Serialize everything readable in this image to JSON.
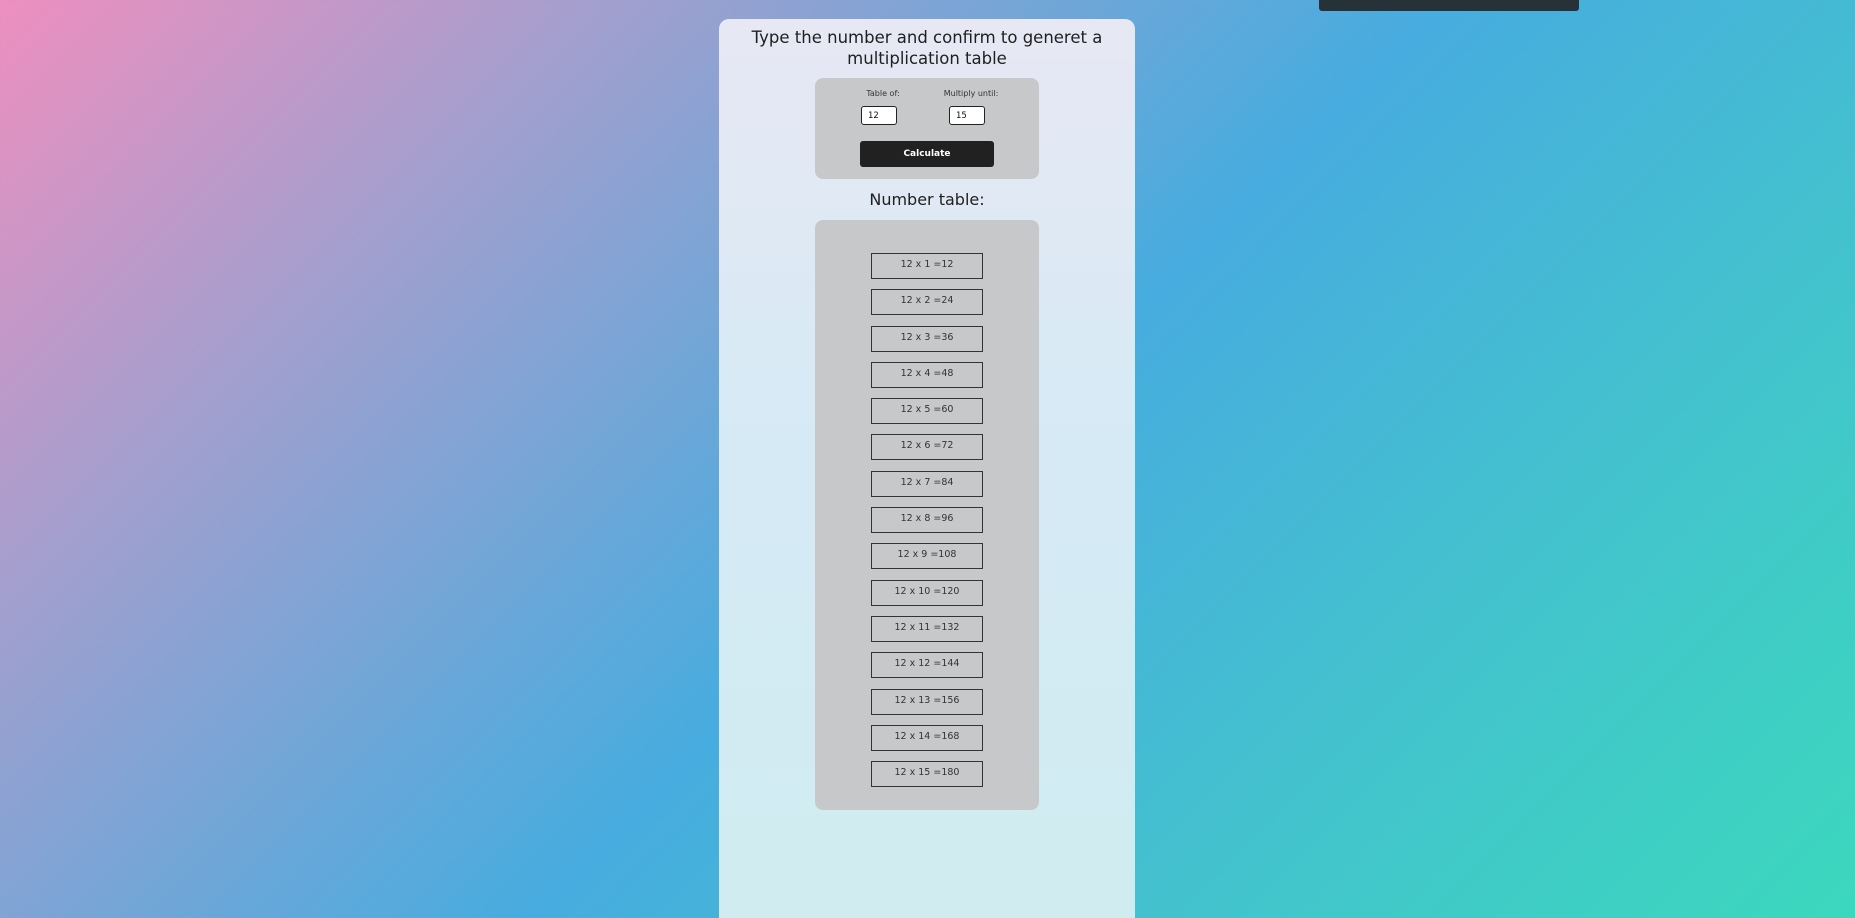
{
  "page": {
    "title": "Type the number and confirm to generet a multiplication table",
    "results_heading": "Number table:"
  },
  "form": {
    "table_of_label": "Table of:",
    "table_of_value": "12",
    "multiply_until_label": "Multiply until:",
    "multiply_until_value": "15",
    "calculate_label": "Calculate"
  },
  "results": [
    "12 x 1 =12",
    "12 x 2 =24",
    "12 x 3 =36",
    "12 x 4 =48",
    "12 x 5 =60",
    "12 x 6 =72",
    "12 x 7 =84",
    "12 x 8 =96",
    "12 x 9 =108",
    "12 x 10 =120",
    "12 x 11 =132",
    "12 x 12 =144",
    "12 x 13 =156",
    "12 x 14 =168",
    "12 x 15 =180"
  ],
  "colors": {
    "button": "#212121",
    "panel": "#c6c8ca",
    "top_bar": "#263238"
  }
}
